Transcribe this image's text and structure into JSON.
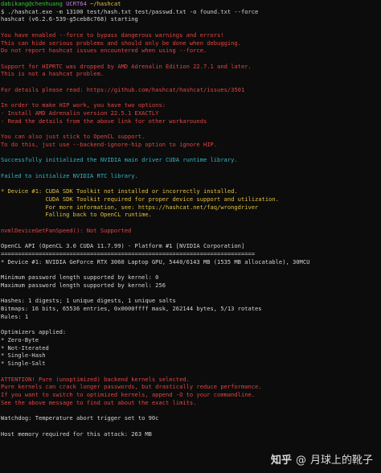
{
  "terminal": {
    "lines": [
      [
        {
          "t": "dabikang@chenhuang ",
          "c": "green"
        },
        {
          "t": "UCRT64 ",
          "c": "purple"
        },
        {
          "t": "~/hashcat",
          "c": "yellow"
        }
      ],
      [
        {
          "t": "$ ./hashcat.exe -m 13100 test/hash.txt test/passwd.txt -o found.txt --force",
          "c": "gray"
        }
      ],
      [
        {
          "t": "hashcat (v6.2.6-539-g5ceb8c768) starting",
          "c": "gray"
        }
      ],
      [],
      [
        {
          "t": "You have enabled --force to bypass dangerous warnings and errors!",
          "c": "red"
        }
      ],
      [
        {
          "t": "This can hide serious problems and should only be done when debugging.",
          "c": "red"
        }
      ],
      [
        {
          "t": "Do not report hashcat issues encountered when using --force.",
          "c": "red"
        }
      ],
      [],
      [
        {
          "t": "Support for HIPRTC was dropped by AMD Adrenalin Edition 22.7.1 and later.",
          "c": "red"
        }
      ],
      [
        {
          "t": "This is not a hashcat problem.",
          "c": "red"
        }
      ],
      [],
      [
        {
          "t": "For details please read: https://github.com/hashcat/hashcat/issues/3501",
          "c": "red"
        }
      ],
      [],
      [
        {
          "t": "In order to make HIP work, you have two options:",
          "c": "red"
        }
      ],
      [
        {
          "t": "- Install AMD Adrenalin version 22.5.1 EXACTLY",
          "c": "red"
        }
      ],
      [
        {
          "t": "- Read the details from the above link for other workarounds",
          "c": "red"
        }
      ],
      [],
      [
        {
          "t": "You can also just stick to OpenCL support.",
          "c": "red"
        }
      ],
      [
        {
          "t": "To do this, just use --backend-ignore-hip option to ignore HIP.",
          "c": "red"
        }
      ],
      [],
      [
        {
          "t": "Successfully initialized the NVIDIA main driver CUDA runtime library.",
          "c": "cyan"
        }
      ],
      [],
      [
        {
          "t": "Failed to initialize NVIDIA RTC library.",
          "c": "cyan"
        }
      ],
      [],
      [
        {
          "t": "* Device #1: CUDA SDK Toolkit not installed or incorrectly installed.",
          "c": "yellow"
        }
      ],
      [
        {
          "t": "             CUDA SDK Toolkit required for proper device support and utilization.",
          "c": "yellow"
        }
      ],
      [
        {
          "t": "             For more information, see: https://hashcat.net/faq/wrongdriver",
          "c": "yellow"
        }
      ],
      [
        {
          "t": "             Falling back to OpenCL runtime.",
          "c": "yellow"
        }
      ],
      [],
      [
        {
          "t": "nvmlDeviceGetFanSpeed(): Not Supported",
          "c": "red"
        }
      ],
      [],
      [
        {
          "t": "OpenCL API (OpenCL 3.0 CUDA 11.7.99) - Platform #1 [NVIDIA Corporation]",
          "c": "gray"
        }
      ],
      [
        {
          "t": "==========================================================================",
          "c": "gray"
        }
      ],
      [
        {
          "t": "* Device #1: NVIDIA GeForce RTX 3060 Laptop GPU, 5440/6143 MB (1535 MB allocatable), 30MCU",
          "c": "gray"
        }
      ],
      [],
      [
        {
          "t": "Minimum password length supported by kernel: 0",
          "c": "gray"
        }
      ],
      [
        {
          "t": "Maximum password length supported by kernel: 256",
          "c": "gray"
        }
      ],
      [],
      [
        {
          "t": "Hashes: 1 digests; 1 unique digests, 1 unique salts",
          "c": "gray"
        }
      ],
      [
        {
          "t": "Bitmaps: 16 bits, 65536 entries, 0x0000ffff mask, 262144 bytes, 5/13 rotates",
          "c": "gray"
        }
      ],
      [
        {
          "t": "Rules: 1",
          "c": "gray"
        }
      ],
      [],
      [
        {
          "t": "Optimizers applied:",
          "c": "gray"
        }
      ],
      [
        {
          "t": "* Zero-Byte",
          "c": "gray"
        }
      ],
      [
        {
          "t": "* Not-Iterated",
          "c": "gray"
        }
      ],
      [
        {
          "t": "* Single-Hash",
          "c": "gray"
        }
      ],
      [
        {
          "t": "* Single-Salt",
          "c": "gray"
        }
      ],
      [],
      [
        {
          "t": "ATTENTION! Pure (unoptimized) backend kernels selected.",
          "c": "red"
        }
      ],
      [
        {
          "t": "Pure kernels can crack longer passwords, but drastically reduce performance.",
          "c": "red"
        }
      ],
      [
        {
          "t": "If you want to switch to optimized kernels, append -O to your commandline.",
          "c": "red"
        }
      ],
      [
        {
          "t": "See the above message to find out about the exact limits.",
          "c": "red"
        }
      ],
      [],
      [
        {
          "t": "Watchdog: Temperature abort trigger set to 90c",
          "c": "gray"
        }
      ],
      [],
      [
        {
          "t": "Host memory required for this attack: 263 MB",
          "c": "gray"
        }
      ]
    ]
  },
  "watermark": {
    "brand": "知乎",
    "separator": "@",
    "author": "月球上的靴子"
  },
  "colors": {
    "background": "#0c0c0c",
    "green": "#35c435",
    "purple": "#c678dd",
    "yellow": "#e0c040",
    "red": "#e24444",
    "cyan": "#32b8c6",
    "gray": "#d4d4d4"
  }
}
